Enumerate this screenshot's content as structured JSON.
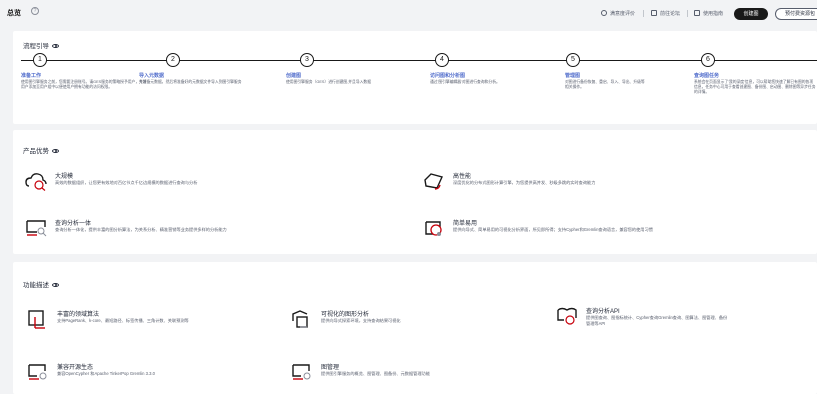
{
  "header": {
    "title": "总览",
    "links": [
      {
        "label": "满意度评价",
        "icon": "smile-icon"
      },
      {
        "label": "前往论坛",
        "icon": "forum-icon"
      },
      {
        "label": "使用指南",
        "icon": "book-icon"
      }
    ],
    "primary_button": "创建图",
    "outline_button": "预付费资源包"
  },
  "flow": {
    "title": "流程引导",
    "steps": [
      {
        "num": "1",
        "name": "准备工作",
        "desc": "使用图引擎服务之前，您需要注册账号。请GES服务的策略授予用户，并将用户添加至用户组中以便使用户拥有功能的访问权限。"
      },
      {
        "num": "2",
        "name": "导入元数据",
        "desc": "先准备元数据，然后将准备好的元数据文件导入到图引擎服务"
      },
      {
        "num": "3",
        "name": "创建图",
        "desc": "使用图引擎服务（GES）进行创建图,并且导入数据"
      },
      {
        "num": "4",
        "name": "访问图和分析图",
        "desc": "通过'图引擎编辑器'对图进行查询和分析。"
      },
      {
        "num": "5",
        "name": "管理图",
        "desc": "对图进行备份恢复、重启、导入、导出、升级等相关操作。"
      },
      {
        "num": "6",
        "name": "查询图任务",
        "desc": "系统会在页面显示了'我的深度'信息，可以帮助您快速了解已有图的各项信息，任务中心可用于查看创建图、备份图、启动图、删除图等异步任务的详情。"
      }
    ]
  },
  "advantages": {
    "title": "产品优势",
    "items": [
      {
        "name": "大规模",
        "desc": "高效的数据组织，让您更有效地对百亿节点千亿边规模的数据进行查询与分析"
      },
      {
        "name": "高性能",
        "desc": "深度优化的分布式图形计算引擎，为您提供高并发、秒级多跳的实时查询能力"
      },
      {
        "name": "查询分析一体",
        "desc": "查询分析一体化，提供丰富的图分析算法，为关系分析、精准营销等业务提供多样的分析能力"
      },
      {
        "name": "简单易用",
        "desc": "提供向导式、简单易用的可视化分析界面，所见即所得；支持Cypher和Gremlin查询语言，兼容您的使用习惯"
      }
    ]
  },
  "functions": {
    "title": "功能描述",
    "items": [
      {
        "name": "丰富的领域算法",
        "desc": "支持PageRank、k-core、最短路径、标签传播、三角计数、关联预测等"
      },
      {
        "name": "可视化的图形分析",
        "desc": "提供向导式探索环境，支持查询结果可视化"
      },
      {
        "name": "查询分析API",
        "desc": "提供图查询、图指标统计、Cypher查询Gremlin查询、图算法、图管理、备份",
        "desc2": "管理等API"
      },
      {
        "name": "兼容开源生态",
        "desc": "兼容OpenCypher 和Apache TinkerPop Gremlin 3.3.0"
      },
      {
        "name": "图管理",
        "desc": "提供图引擎服务的概览、图管理、图备份、元数据管理功能"
      }
    ]
  },
  "colors": {
    "accent": "#526ecc",
    "dark": "#191919",
    "icon_red": "#c7000b"
  }
}
